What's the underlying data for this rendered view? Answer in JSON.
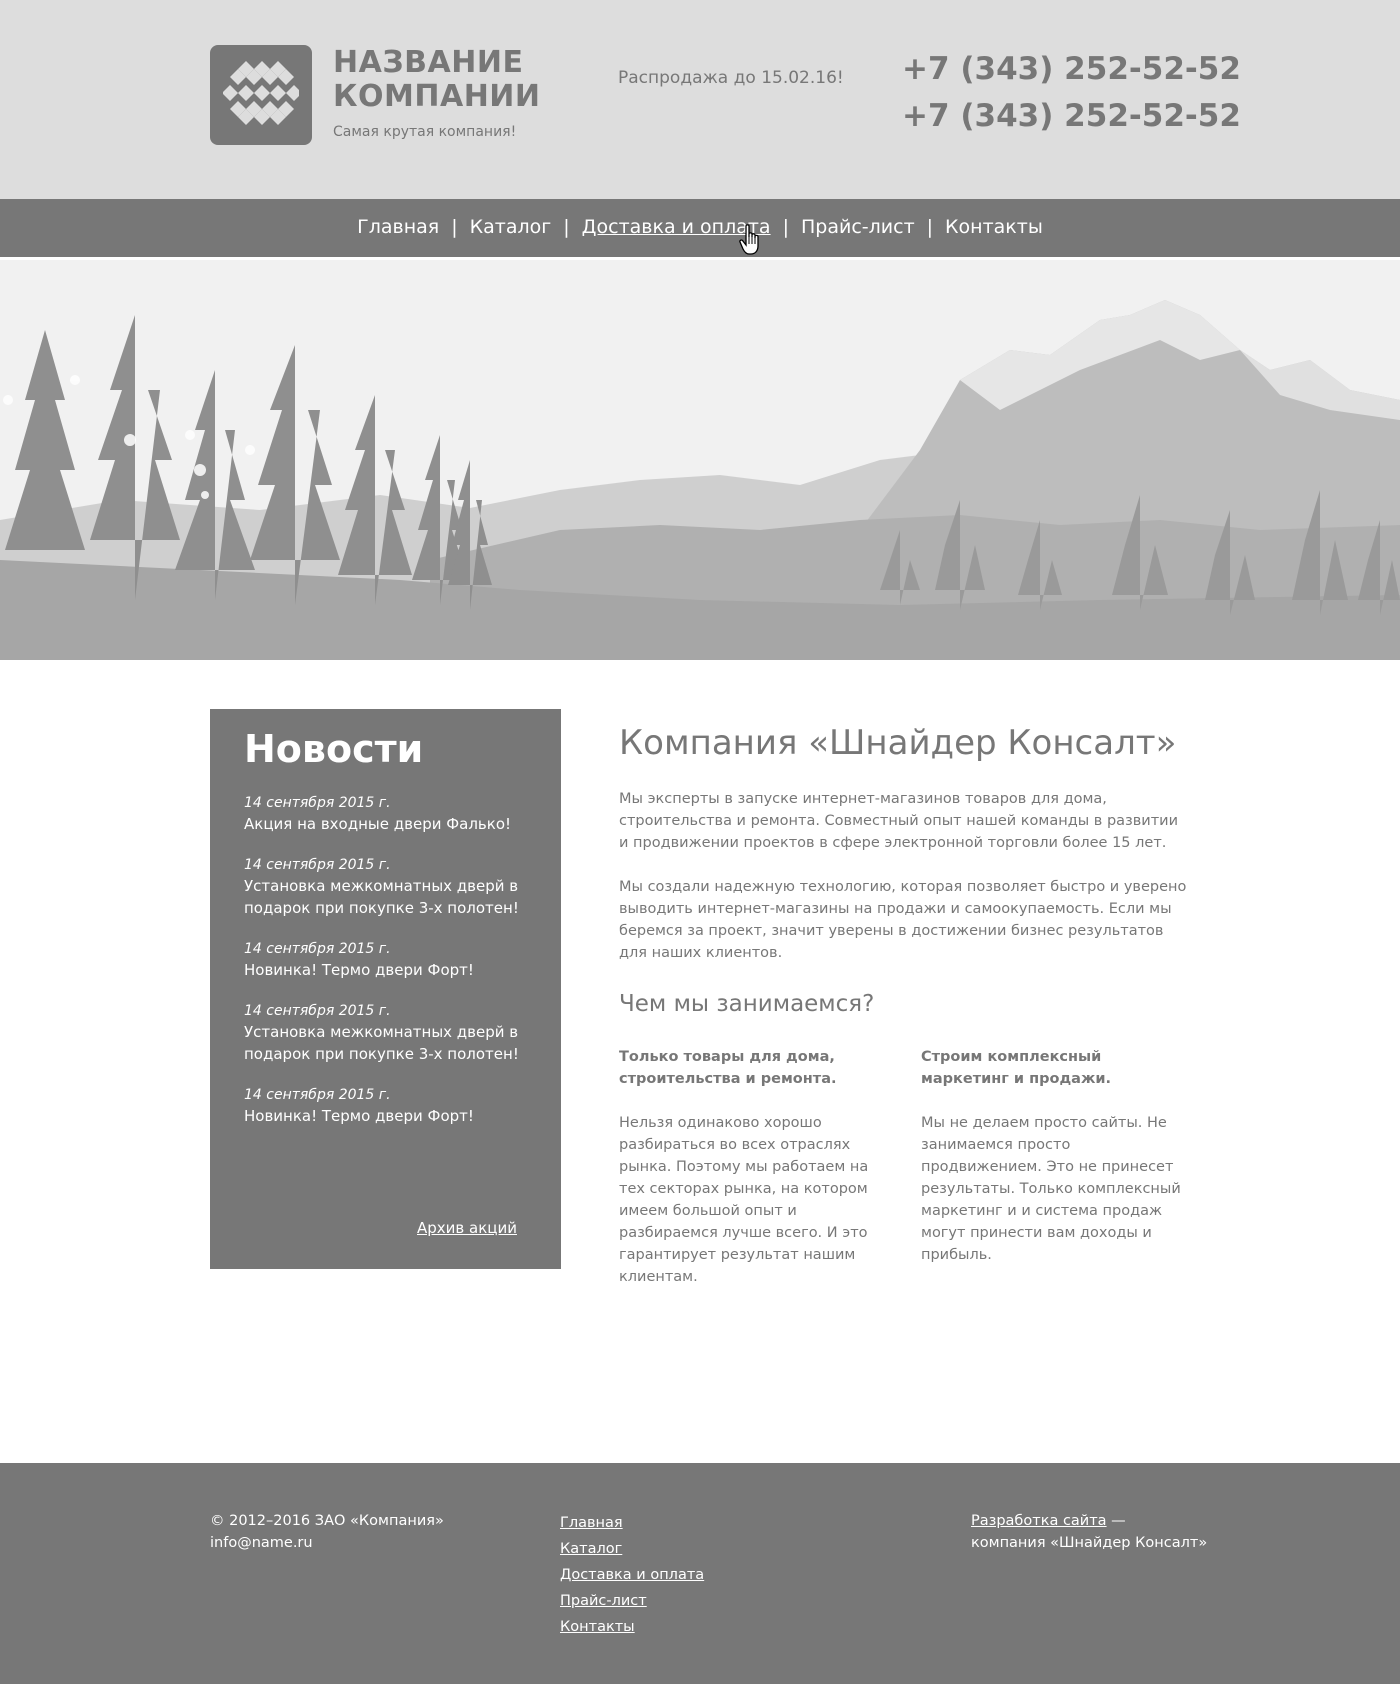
{
  "header": {
    "company_name_line1": "НАЗВАНИЕ",
    "company_name_line2": "КОМПАНИИ",
    "tagline": "Самая крутая компания!",
    "sale": "Распродажа до 15.02.16!",
    "phone1": "+7 (343) 252-52-52",
    "phone2": "+7 (343) 252-52-52",
    "logo_icon": "diamond-grid-logo"
  },
  "nav": {
    "items": [
      {
        "label": "Главная"
      },
      {
        "label": "Каталог"
      },
      {
        "label": "Доставка и оплата"
      },
      {
        "label": "Прайс-лист"
      },
      {
        "label": "Контакты"
      }
    ],
    "separator": "|",
    "cursor_icon": "hand-pointer-cursor"
  },
  "banner": {
    "image": "mountain-forest-landscape"
  },
  "news": {
    "title": "Новости",
    "items": [
      {
        "date": "14 сентября 2015 г.",
        "text": "Акция на входные двери Фалько!"
      },
      {
        "date": "14 сентября 2015 г.",
        "text": "Установка межкомнатных дверй в подарок при покупке 3-х полотен!"
      },
      {
        "date": "14 сентября 2015 г.",
        "text": "Новинка! Термо двери Форт!"
      },
      {
        "date": "14 сентября 2015 г.",
        "text": "Установка межкомнатных дверй в подарок при покупке 3-х полотен!"
      },
      {
        "date": "14 сентября 2015 г.",
        "text": "Новинка! Термо двери Форт!"
      }
    ],
    "archive_link": "Архив акций"
  },
  "main": {
    "title": "Компания «Шнайдер Консалт»",
    "paragraph1": "Мы эксперты в запуске интернет-магазинов товаров для дома, строительства и ремонта. Совместный опыт нашей команды в развитии и продвижении проектов в сфере электронной торговли более 15 лет.",
    "paragraph2": "Мы создали надежную технологию, которая позволяет быстро и уверено выводить интернет-магазины на продажи и самоокупаемость. Если мы беремся за проект, значит уверены в достижении бизнес результатов для наших клиентов.",
    "subtitle": "Чем мы занимаемся?",
    "col1_heading": "Только товары для дома, строительства и ремонта.",
    "col1_text": "Нельзя одинаково хорошо разбираться во всех отраслях рынка. Поэтому мы работаем на тех секторах рынка, на котором имеем большой опыт и разбираемся лучше всего. И это гарантирует результат нашим клиентам.",
    "col2_heading": "Строим комплексный маркетинг и продажи.",
    "col2_text": "Мы не делаем просто сайты. Не занимаемся просто продвижением. Это не принесет результаты. Только комплексный маркетинг и и система продаж могут принести вам доходы и прибыль."
  },
  "footer": {
    "copyright": "© 2012–2016 ЗАО «Компания»",
    "email": "info@name.ru",
    "links": [
      {
        "label": "Главная"
      },
      {
        "label": "Каталог"
      },
      {
        "label": "Доставка и оплата"
      },
      {
        "label": "Прайс-лист"
      },
      {
        "label": "Контакты"
      }
    ],
    "dev_link": "Разработка сайта",
    "dev_dash": " —",
    "dev_company": "компания «Шнайдер Консалт»"
  },
  "colors": {
    "header_bg": "#dddddd",
    "dark_gray": "#777777",
    "text_gray": "#777777",
    "white": "#ffffff"
  }
}
